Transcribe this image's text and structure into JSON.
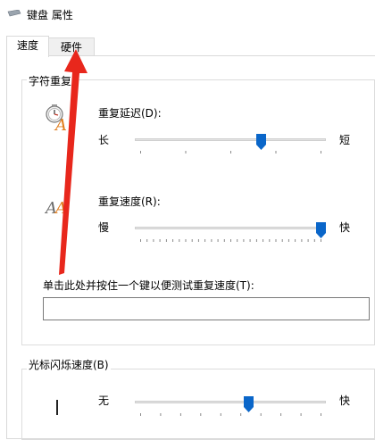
{
  "window": {
    "title": "键盘 属性"
  },
  "tabs": [
    {
      "label": "速度",
      "active": true
    },
    {
      "label": "硬件",
      "active": false
    }
  ],
  "char_repeat": {
    "legend": "字符重复",
    "delay": {
      "label": "重复延迟(D):",
      "min_label": "长",
      "max_label": "短",
      "value_fraction": 0.67
    },
    "rate": {
      "label": "重复速度(R):",
      "min_label": "慢",
      "max_label": "快",
      "value_fraction": 1.0
    },
    "test": {
      "label": "单击此处并按住一个键以便测试重复速度(T):",
      "value": ""
    }
  },
  "cursor_blink": {
    "legend": "光标闪烁速度(B)",
    "min_label": "无",
    "max_label": "快",
    "value_fraction": 0.6
  },
  "colors": {
    "accent": "#0a66c9",
    "annotation_arrow": "#e8271c"
  }
}
